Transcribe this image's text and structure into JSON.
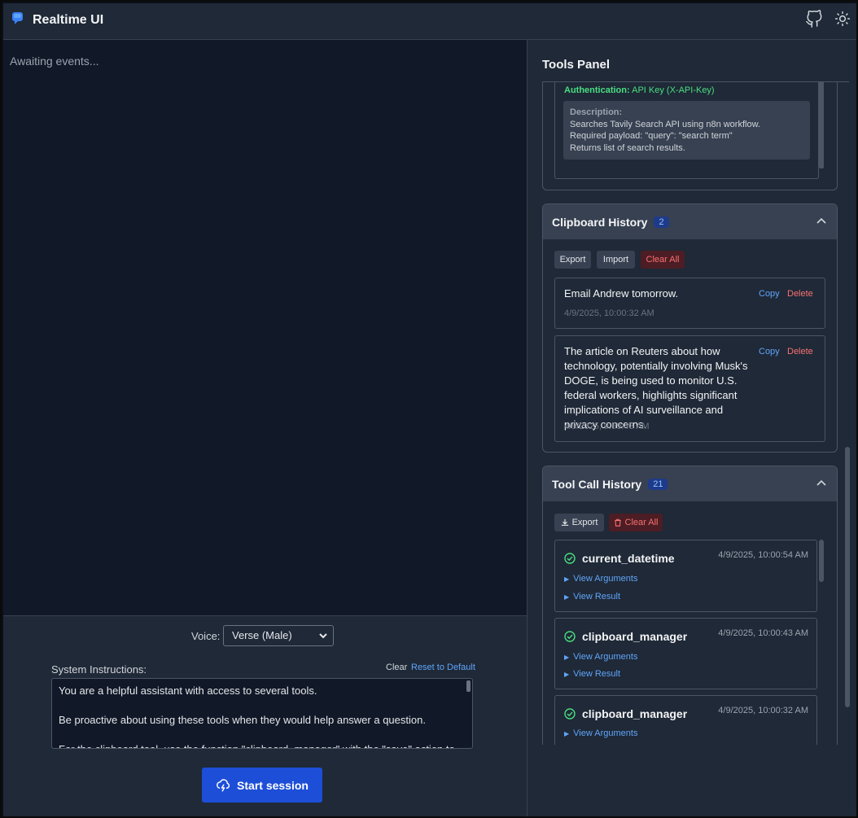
{
  "header": {
    "title": "Realtime UI",
    "github_icon": "github-icon",
    "theme_icon": "sun-icon"
  },
  "events": {
    "placeholder": "Awaiting events..."
  },
  "controls": {
    "voice_label": "Voice:",
    "voice_value": "Verse (Male)",
    "system_label": "System Instructions:",
    "clear_label": "Clear",
    "reset_label": "Reset to Default",
    "system_text": [
      "You are a helpful assistant with access to several tools.",
      "Be proactive about using these tools when they would help answer a question.",
      "For the clipboard tool, use the function \"clipboard_manager\" with the \"save\" action to"
    ],
    "start_label": "Start session"
  },
  "tools_panel": {
    "title": "Tools Panel",
    "api_card": {
      "auth_label": "Authentication:",
      "auth_value": "API Key (X-API-Key)",
      "desc_label": "Description:",
      "desc_lines": [
        "Searches Tavily Search API using n8n workflow.",
        "Required payload: \"query\": \"search term\"",
        "Returns list of search results."
      ]
    },
    "clipboard": {
      "title": "Clipboard History",
      "count": "2",
      "export_label": "Export",
      "import_label": "Import",
      "clear_all_label": "Clear All",
      "copy_label": "Copy",
      "delete_label": "Delete",
      "items": [
        {
          "text": "Email Andrew tomorrow.",
          "time": "4/9/2025, 10:00:32 AM"
        },
        {
          "text": "The article on Reuters about how technology, potentially involving Musk's DOGE, is being used to monitor U.S. federal workers, highlights significant implications of AI surveillance and privacy concerns.",
          "time": "4/9/2025, 9:59:43 AM"
        }
      ]
    },
    "tool_calls": {
      "title": "Tool Call History",
      "count": "21",
      "export_label": "Export",
      "clear_all_label": "Clear All",
      "view_args_label": "View Arguments",
      "view_result_label": "View Result",
      "items": [
        {
          "name": "current_datetime",
          "time": "4/9/2025, 10:00:54 AM"
        },
        {
          "name": "clipboard_manager",
          "time": "4/9/2025, 10:00:43 AM"
        },
        {
          "name": "clipboard_manager",
          "time": "4/9/2025, 10:00:32 AM"
        }
      ]
    }
  },
  "colors": {
    "accent": "#1d4ed8",
    "link": "#60a5fa",
    "danger": "#f87171",
    "success": "#4ade80"
  }
}
